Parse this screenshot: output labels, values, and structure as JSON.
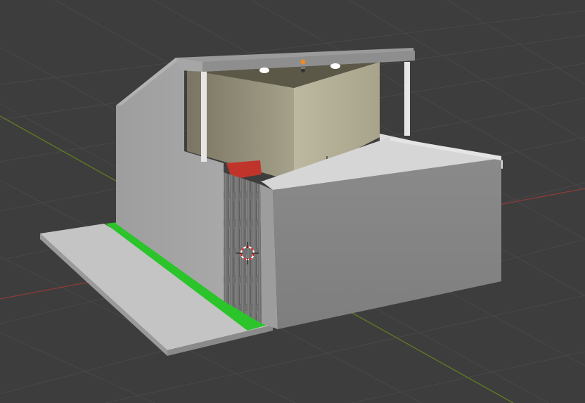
{
  "viewport": {
    "name": "3D Viewport",
    "background_color": "#3d3d3d",
    "grid_color": "#4a4a4a",
    "x_axis_color": "#a03a3a",
    "y_axis_color": "#6b8e23"
  },
  "scene": {
    "objects": [
      {
        "name": "walkway-slab",
        "color": "#c8c8c8"
      },
      {
        "name": "green-strip",
        "color": "#22c522"
      },
      {
        "name": "building-walls",
        "color": "#8e8e8e"
      },
      {
        "name": "roof-canopy",
        "color": "#9a9a9a"
      },
      {
        "name": "door",
        "material": "wood-grey"
      },
      {
        "name": "interior-red-object",
        "color": "#c0342b"
      },
      {
        "name": "ceiling-lights",
        "count": 3
      }
    ],
    "gizmos": {
      "cursor_3d": "cursor-3d-icon",
      "object_origin": "object-origin-icon",
      "light_marker": "light-marker-icon"
    }
  }
}
